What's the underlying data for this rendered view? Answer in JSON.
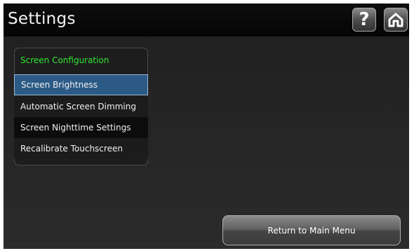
{
  "header": {
    "title": "Settings",
    "help_glyph": "?",
    "help_icon": "question-mark-icon",
    "home_icon": "home-icon"
  },
  "panel": {
    "header": "Screen Configuration",
    "items": [
      {
        "label": "Screen Brightness",
        "selected": true
      },
      {
        "label": "Automatic Screen Dimming",
        "selected": false
      },
      {
        "label": "Screen Nighttime Settings",
        "selected": false
      },
      {
        "label": "Recalibrate Touchscreen",
        "selected": false
      }
    ]
  },
  "footer": {
    "return_label": "Return to Main Menu"
  },
  "colors": {
    "accent_green": "#2ee82e",
    "selected_blue": "#2c5a86"
  }
}
